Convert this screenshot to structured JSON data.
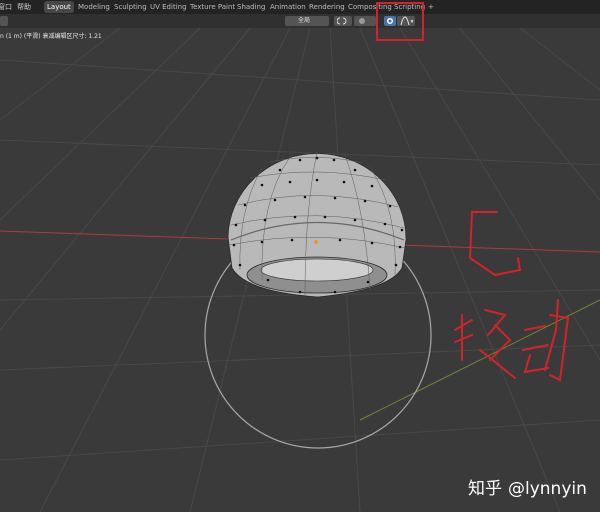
{
  "menu": {
    "items": [
      {
        "label": "窗口"
      },
      {
        "label": "帮助"
      }
    ]
  },
  "workspace_tabs": [
    {
      "label": "Layout",
      "active": true
    },
    {
      "label": "Modeling"
    },
    {
      "label": "Sculpting"
    },
    {
      "label": "UV Editing"
    },
    {
      "label": "Texture Paint"
    },
    {
      "label": "Shading"
    },
    {
      "label": "Animation"
    },
    {
      "label": "Rendering"
    },
    {
      "label": "Compositing"
    },
    {
      "label": "Scripting"
    },
    {
      "label": "+"
    }
  ],
  "header": {
    "transform_orientation": "全局",
    "snap_icon": "magnet-icon",
    "proportional_icon": "proportional-editing-icon",
    "falloff_icon": "falloff-curve-icon"
  },
  "status": {
    "text": "n (1 m) (平滑)   衰减编辑区尺寸: 1.21"
  },
  "annotation": {
    "letter": "G",
    "text": "移动",
    "color": "#d2232a"
  },
  "watermark": {
    "site": "知乎",
    "handle": "@lynnyin"
  },
  "colors": {
    "viewport_bg": "#3a3a3a",
    "topbar_bg": "#232323",
    "x_axis": "#b03a3a",
    "y_axis": "#6f8a2e",
    "annotation_red": "#d2232a"
  }
}
